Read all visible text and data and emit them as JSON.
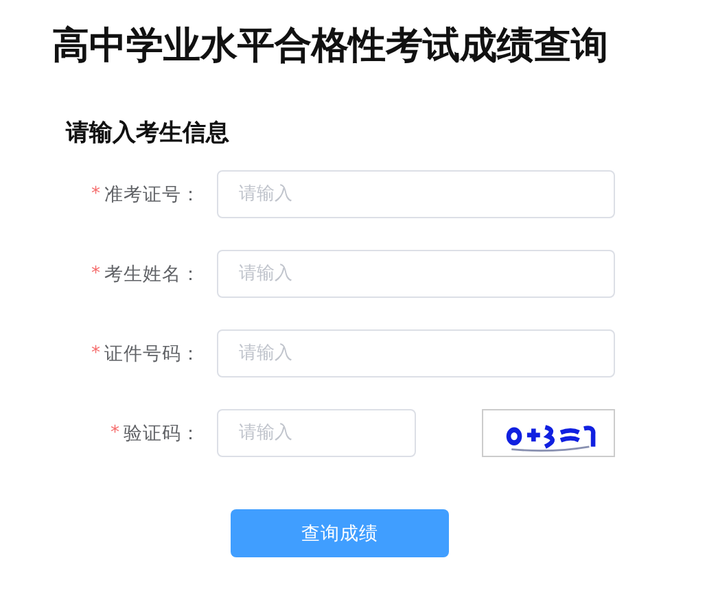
{
  "title": "高中学业水平合格性考试成绩查询",
  "section_title": "请输入考生信息",
  "fields": [
    {
      "kind": "text",
      "required_mark": "*",
      "label": "准考证号：",
      "placeholder": "请输入"
    },
    {
      "kind": "text",
      "required_mark": "*",
      "label": "考生姓名：",
      "placeholder": "请输入"
    },
    {
      "kind": "text",
      "required_mark": "*",
      "label": "证件号码：",
      "placeholder": "请输入"
    },
    {
      "kind": "captcha",
      "required_mark": "*",
      "label": "验证码：",
      "placeholder": "请输入"
    }
  ],
  "submit_button": "查询成绩"
}
